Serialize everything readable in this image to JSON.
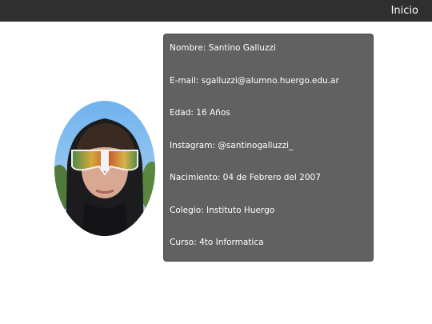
{
  "nav": {
    "home_label": "Inicio"
  },
  "profile": {
    "name_line": "Nombre: Santino Galluzzi",
    "email_line": "E-mail: sgalluzzi@alumno.huergo.edu.ar",
    "age_line": "Edad: 16 Años",
    "instagram_line": "Instagram: @santinogalluzzi_",
    "birth_line": "Nacimiento: 04 de Febrero del 2007",
    "school_line": "Colegio: Instituto Huergo",
    "course_line": "Curso: 4to Informatica"
  },
  "colors": {
    "topbar": "#2f2f2f",
    "card": "#616161"
  }
}
